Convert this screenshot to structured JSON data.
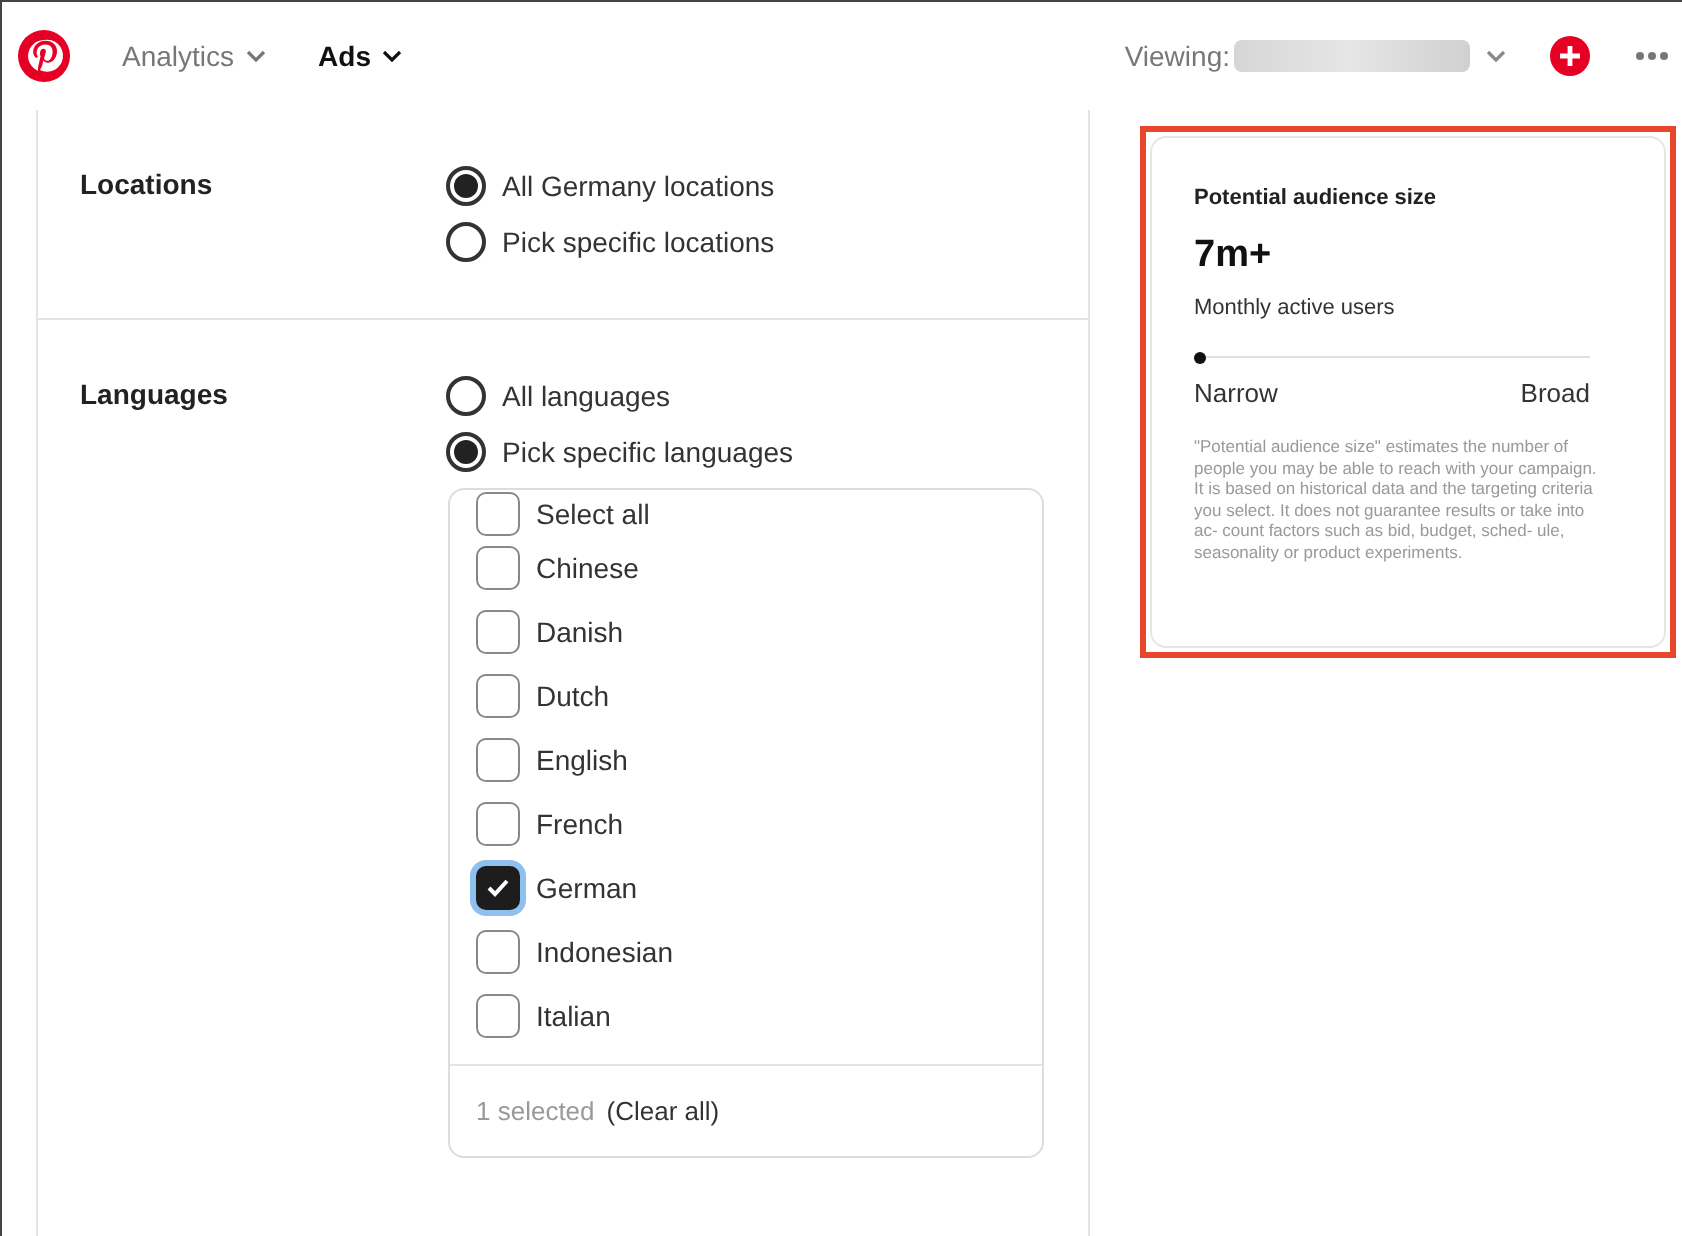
{
  "nav": {
    "items": [
      {
        "label": "Analytics",
        "selected": false
      },
      {
        "label": "Ads",
        "selected": true
      }
    ],
    "viewing_label": "Viewing:"
  },
  "sections": [
    {
      "label": "Locations",
      "options": [
        {
          "label": "All Germany locations",
          "selected": true
        },
        {
          "label": "Pick specific locations",
          "selected": false
        }
      ]
    },
    {
      "label": "Languages",
      "options": [
        {
          "label": "All languages",
          "selected": false
        },
        {
          "label": "Pick specific languages",
          "selected": true
        }
      ],
      "list": {
        "items": [
          {
            "label": "Select all",
            "checked": false
          },
          {
            "label": "Chinese",
            "checked": false
          },
          {
            "label": "Danish",
            "checked": false
          },
          {
            "label": "Dutch",
            "checked": false
          },
          {
            "label": "English",
            "checked": false
          },
          {
            "label": "French",
            "checked": false
          },
          {
            "label": "German",
            "checked": true
          },
          {
            "label": "Indonesian",
            "checked": false
          },
          {
            "label": "Italian",
            "checked": false
          }
        ],
        "count": "1 selected",
        "clear": "(Clear all)"
      }
    }
  ],
  "audience": {
    "title": "Potential audience size",
    "value": "7m+",
    "caption": "Monthly active users",
    "level": 0,
    "min_label": "Narrow",
    "max_label": "Broad",
    "note": "\"Potential audience size\" estimates the number of people you may be able to reach with your campaign. It is based on historical data and the targeting criteria you select. It does not guarantee results or take into ac- count factors such as bid, budget, sched- ule, seasonality or product experiments."
  }
}
